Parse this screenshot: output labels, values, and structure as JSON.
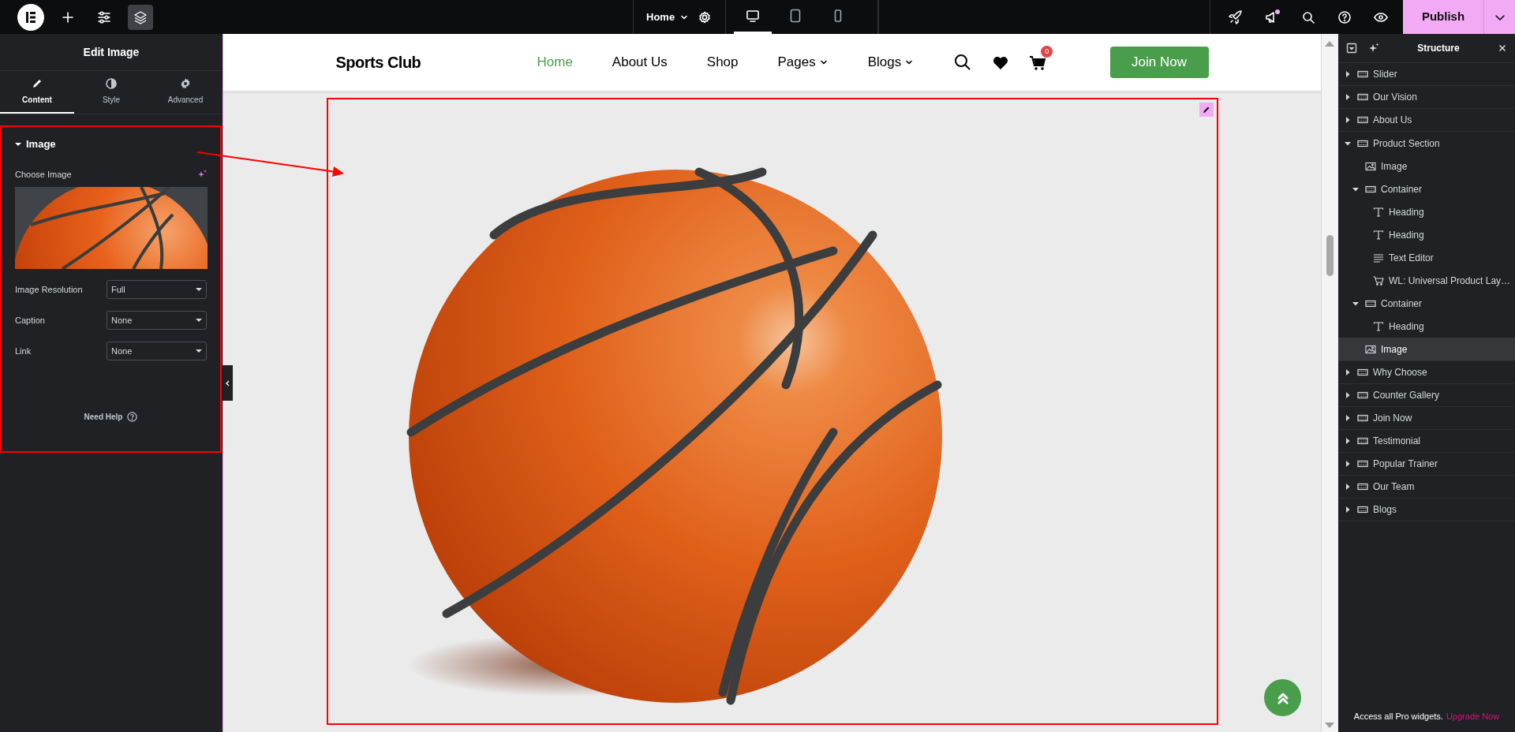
{
  "top_bar": {
    "page_menu": "Home",
    "devices": [
      {
        "kind": "desktop",
        "selected": true
      },
      {
        "kind": "tablet",
        "selected": false
      },
      {
        "kind": "mobile",
        "selected": false
      }
    ],
    "publish": "Publish"
  },
  "panel": {
    "title": "Edit Image",
    "tabs": [
      {
        "label": "Content",
        "kind": "content",
        "selected": true
      },
      {
        "label": "Style",
        "kind": "style",
        "selected": false
      },
      {
        "label": "Advanced",
        "kind": "advanced",
        "selected": false
      }
    ],
    "section": {
      "title": "Image",
      "expanded": true
    },
    "choose_image_label": "Choose Image",
    "fields": [
      {
        "label": "Image Resolution",
        "value": "Full"
      },
      {
        "label": "Caption",
        "value": "None"
      },
      {
        "label": "Link",
        "value": "None"
      }
    ],
    "help": "Need Help"
  },
  "site": {
    "logo": "Sports Club",
    "nav": [
      {
        "label": "Home",
        "selected": true,
        "dropdown": false
      },
      {
        "label": "About Us",
        "selected": false,
        "dropdown": false
      },
      {
        "label": "Shop",
        "selected": false,
        "dropdown": false
      },
      {
        "label": "Pages",
        "selected": false,
        "dropdown": true
      },
      {
        "label": "Blogs",
        "selected": false,
        "dropdown": true
      }
    ],
    "cart_count": "0",
    "cta": "Join Now"
  },
  "structure": {
    "title": "Structure",
    "items": [
      {
        "label": "Slider",
        "kind": "container",
        "expanded": false,
        "selected": false
      },
      {
        "label": "Our Vision",
        "kind": "container",
        "expanded": false,
        "selected": false
      },
      {
        "label": "About Us",
        "kind": "container",
        "expanded": false,
        "selected": false
      },
      {
        "label": "Product Section",
        "kind": "container",
        "expanded": true,
        "selected": false,
        "children": [
          {
            "label": "Image",
            "kind": "image",
            "selected": false
          },
          {
            "label": "Container",
            "kind": "container",
            "expanded": true,
            "selected": false,
            "children": [
              {
                "label": "Heading",
                "kind": "heading",
                "selected": false
              },
              {
                "label": "Heading",
                "kind": "heading",
                "selected": false
              },
              {
                "label": "Text Editor",
                "kind": "text",
                "selected": false
              },
              {
                "label": "WL: Universal Product Lay…",
                "kind": "cart",
                "selected": false
              }
            ]
          },
          {
            "label": "Container",
            "kind": "container",
            "expanded": true,
            "selected": false,
            "children": [
              {
                "label": "Heading",
                "kind": "heading",
                "selected": false
              }
            ]
          },
          {
            "label": "Image",
            "kind": "image",
            "selected": true
          }
        ]
      },
      {
        "label": "Why Choose",
        "kind": "container",
        "expanded": false,
        "selected": false
      },
      {
        "label": "Counter Gallery",
        "kind": "container",
        "expanded": false,
        "selected": false
      },
      {
        "label": "Join Now",
        "kind": "container",
        "expanded": false,
        "selected": false
      },
      {
        "label": "Testimonial",
        "kind": "container",
        "expanded": false,
        "selected": false
      },
      {
        "label": "Popular Trainer",
        "kind": "container",
        "expanded": false,
        "selected": false
      },
      {
        "label": "Our Team",
        "kind": "container",
        "expanded": false,
        "selected": false
      },
      {
        "label": "Blogs",
        "kind": "container",
        "expanded": false,
        "selected": false
      }
    ]
  },
  "promo": {
    "text": "Access all Pro widgets.",
    "link": "Upgrade Now"
  }
}
